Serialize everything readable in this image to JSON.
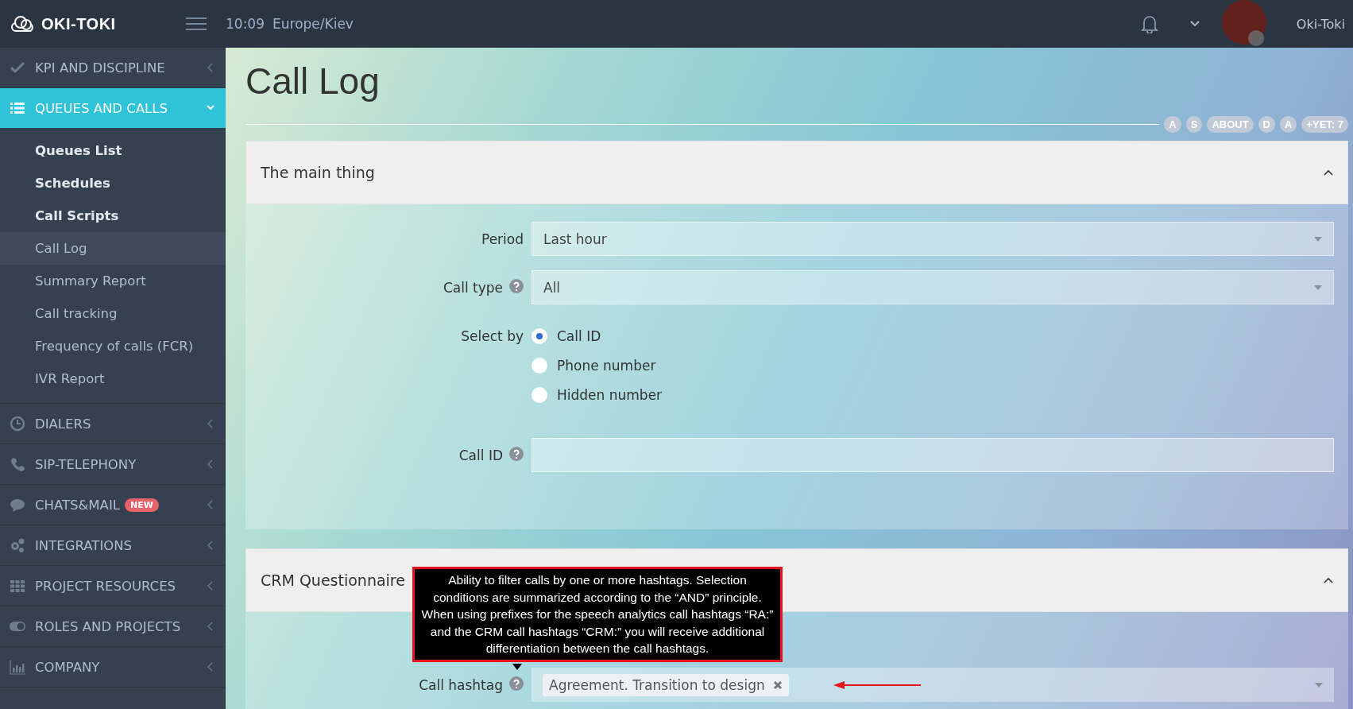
{
  "brand": {
    "name": "OKI-TOKI"
  },
  "topbar": {
    "time": "10:09",
    "timezone": "Europe/Kiev",
    "user": "Oki-Toki"
  },
  "sidebar": {
    "items": [
      {
        "label": "KPI AND DISCIPLINE",
        "expanded": false
      },
      {
        "label": "QUEUES AND CALLS",
        "expanded": true,
        "children": [
          {
            "label": "Queues List",
            "kind": "heading",
            "selected": false
          },
          {
            "label": "Schedules",
            "kind": "heading",
            "selected": false
          },
          {
            "label": "Call Scripts",
            "kind": "heading",
            "selected": false
          },
          {
            "label": "Call Log",
            "kind": "link",
            "selected": true
          },
          {
            "label": "Summary Report",
            "kind": "link",
            "selected": false
          },
          {
            "label": "Call tracking",
            "kind": "link",
            "selected": false
          },
          {
            "label": "Frequency of calls (FCR)",
            "kind": "link",
            "selected": false
          },
          {
            "label": "IVR Report",
            "kind": "link",
            "selected": false
          }
        ]
      },
      {
        "label": "DIALERS",
        "expanded": false
      },
      {
        "label": "SIP-TELEPHONY",
        "expanded": false
      },
      {
        "label": "CHATS&MAIL",
        "expanded": false,
        "badge": "NEW"
      },
      {
        "label": "INTEGRATIONS",
        "expanded": false
      },
      {
        "label": "PROJECT RESOURCES",
        "expanded": false
      },
      {
        "label": "ROLES AND PROJECTS",
        "expanded": false
      },
      {
        "label": "COMPANY",
        "expanded": false
      }
    ]
  },
  "page": {
    "title": "Call Log",
    "pills": [
      "A",
      "S",
      "ABOUT",
      "D",
      "A",
      "+YET: 7"
    ]
  },
  "cards": [
    {
      "title": "The main thing",
      "expanded": true,
      "fields": [
        {
          "kind": "select",
          "label": "Period",
          "value": "Last hour",
          "help": false
        },
        {
          "kind": "select",
          "label": "Call type",
          "value": "All",
          "help": true
        },
        {
          "kind": "radio",
          "label": "Select by",
          "options": [
            {
              "label": "Call ID",
              "selected": true
            },
            {
              "label": "Phone number",
              "selected": false
            },
            {
              "label": "Hidden number",
              "selected": false
            }
          ]
        },
        {
          "kind": "text",
          "label": "Call ID",
          "help": true
        }
      ]
    },
    {
      "title": "CRM Questionnaire",
      "expanded": true,
      "fields": [
        {
          "kind": "tags",
          "label": "Call hashtag",
          "help": true,
          "tags": [
            "Agreement. Transition to design"
          ],
          "tooltip": "Ability to filter calls by one or more hashtags. Selection conditions are summarized according to the “AND” principle. When using prefixes for the speech analytics call hashtags “RA:” and the CRM call hashtags “CRM:” you will receive additional differentiation between the call hashtags."
        }
      ]
    }
  ]
}
